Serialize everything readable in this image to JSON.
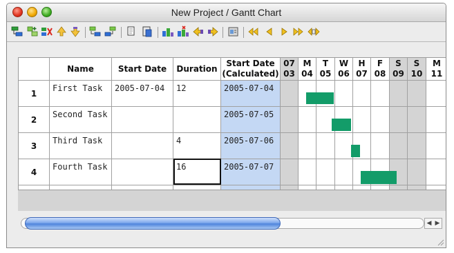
{
  "window": {
    "title": "New Project / Gantt Chart"
  },
  "toolbar": {
    "icons": [
      "add-task-icon",
      "add-subtask-icon",
      "delete-task-icon",
      "move-up-icon",
      "move-down-icon",
      "indent-icon",
      "outdent-icon",
      "copy-icon",
      "paste-icon",
      "link-tasks-icon",
      "unlink-tasks-icon",
      "scroll-left-icon",
      "scroll-right-icon",
      "task-properties-icon",
      "zoom-first-icon",
      "zoom-prev-icon",
      "zoom-next-icon",
      "zoom-last-icon",
      "zoom-fit-icon"
    ]
  },
  "table": {
    "headers": {
      "name": "Name",
      "start_date": "Start Date",
      "duration": "Duration",
      "calc_line1": "Start Date",
      "calc_line2": "(Calculated)"
    },
    "days": [
      {
        "wd": "07",
        "dd": "03",
        "weekend": true
      },
      {
        "wd": "M",
        "dd": "04",
        "weekend": false
      },
      {
        "wd": "T",
        "dd": "05",
        "weekend": false
      },
      {
        "wd": "W",
        "dd": "06",
        "weekend": false
      },
      {
        "wd": "H",
        "dd": "07",
        "weekend": false
      },
      {
        "wd": "F",
        "dd": "08",
        "weekend": false
      },
      {
        "wd": "S",
        "dd": "09",
        "weekend": true
      },
      {
        "wd": "S",
        "dd": "10",
        "weekend": true
      },
      {
        "wd": "M",
        "dd": "11",
        "weekend": false
      }
    ],
    "rows": [
      {
        "num": "1",
        "name": "First Task",
        "start": "2005-07-04",
        "duration": "12",
        "calc": "2005-07-04"
      },
      {
        "num": "2",
        "name": "Second Task",
        "start": "",
        "duration": "",
        "calc": "2005-07-05"
      },
      {
        "num": "3",
        "name": "Third Task",
        "start": "",
        "duration": "4",
        "calc": "2005-07-06"
      },
      {
        "num": "4",
        "name": "Fourth Task",
        "start": "",
        "duration": "16",
        "calc": "2005-07-07"
      }
    ]
  },
  "colors": {
    "bar": "#139c69",
    "calc_bg": "#c4d8f4",
    "weekend_bg": "#d4d4d4",
    "scroll_thumb": "#4f84dc"
  }
}
